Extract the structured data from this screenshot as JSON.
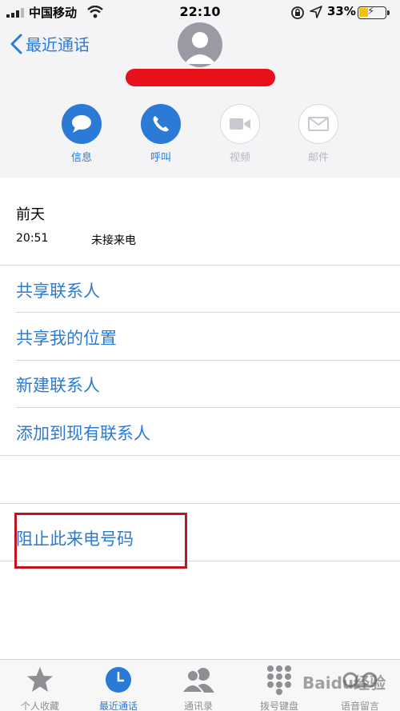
{
  "status_bar": {
    "carrier": "中国移动",
    "time": "22:10",
    "battery": "33%"
  },
  "nav": {
    "back_label": "最近通话"
  },
  "actions": [
    {
      "label": "信息",
      "icon": "message-icon",
      "enabled": true
    },
    {
      "label": "呼叫",
      "icon": "phone-icon",
      "enabled": true
    },
    {
      "label": "视频",
      "icon": "video-icon",
      "enabled": false
    },
    {
      "label": "邮件",
      "icon": "mail-icon",
      "enabled": false
    }
  ],
  "call_log": {
    "day": "前天",
    "time": "20:51",
    "type": "未接来电"
  },
  "menu": [
    "共享联系人",
    "共享我的位置",
    "新建联系人",
    "添加到现有联系人"
  ],
  "block": {
    "label": "阻止此来电号码"
  },
  "tabs": [
    {
      "label": "个人收藏",
      "icon": "star-icon",
      "active": false
    },
    {
      "label": "最近通话",
      "icon": "clock-icon",
      "active": true
    },
    {
      "label": "通讯录",
      "icon": "contacts-icon",
      "active": false
    },
    {
      "label": "拨号键盘",
      "icon": "keypad-icon",
      "active": false
    },
    {
      "label": "语音留言",
      "icon": "voicemail-icon",
      "active": false
    }
  ],
  "watermark": "Baidu经验",
  "colors": {
    "accent": "#2a7ad6",
    "highlight": "#c4121e",
    "redaction": "#e8101a"
  }
}
